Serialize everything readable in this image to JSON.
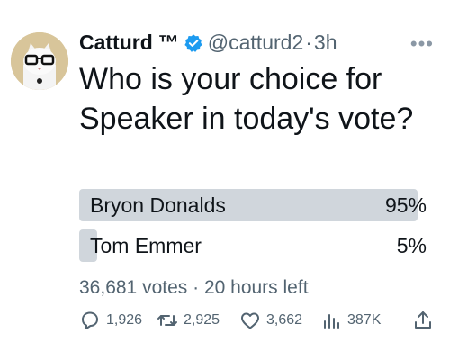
{
  "author": {
    "name": "Catturd",
    "tm": "™",
    "handle": "@catturd2",
    "separator": "·",
    "time": "3h"
  },
  "tweet": {
    "text": "Who is your choice for Speaker in today's vote?"
  },
  "poll": {
    "options": [
      {
        "label": "Bryon Donalds",
        "percent_text": "95%",
        "percent": 95
      },
      {
        "label": "Tom Emmer",
        "percent_text": "5%",
        "percent": 5
      }
    ],
    "votes": "36,681 votes",
    "separator": "·",
    "time_left": "20 hours left"
  },
  "actions": {
    "replies": "1,926",
    "retweets": "2,925",
    "likes": "3,662",
    "views": "387K"
  },
  "icons": [
    "verified-badge-icon",
    "more-icon",
    "reply-icon",
    "retweet-icon",
    "like-icon",
    "views-icon",
    "share-icon"
  ],
  "colors": {
    "verified": "#1d9bf0",
    "muted": "#536471",
    "bar": "#d0d6dc"
  }
}
